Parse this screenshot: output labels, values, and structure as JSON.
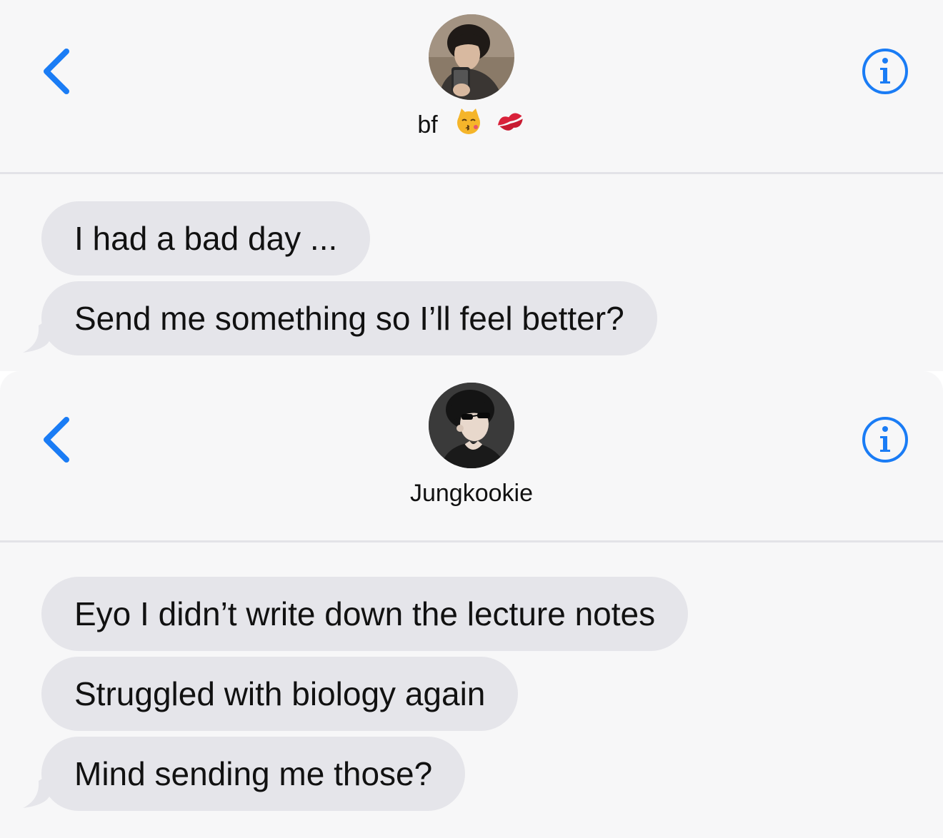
{
  "colors": {
    "accent": "#1a7cf5",
    "bubble": "#e5e5ea",
    "background": "#f7f7f8",
    "text": "#111111"
  },
  "chats": [
    {
      "contact": {
        "name": "bf",
        "emojis": [
          "kissing-cat-emoji",
          "kiss-mark-emoji"
        ]
      },
      "icons": {
        "back": "chevron-left-icon",
        "info": "info-icon"
      },
      "messages": [
        "I had a bad day ...",
        "Send me something so I’ll feel better?"
      ]
    },
    {
      "contact": {
        "name": "Jungkookie"
      },
      "icons": {
        "back": "chevron-left-icon",
        "info": "info-icon"
      },
      "messages": [
        "Eyo I didn’t write down the lecture notes",
        "Struggled with biology again",
        "Mind sending me those?"
      ]
    }
  ]
}
